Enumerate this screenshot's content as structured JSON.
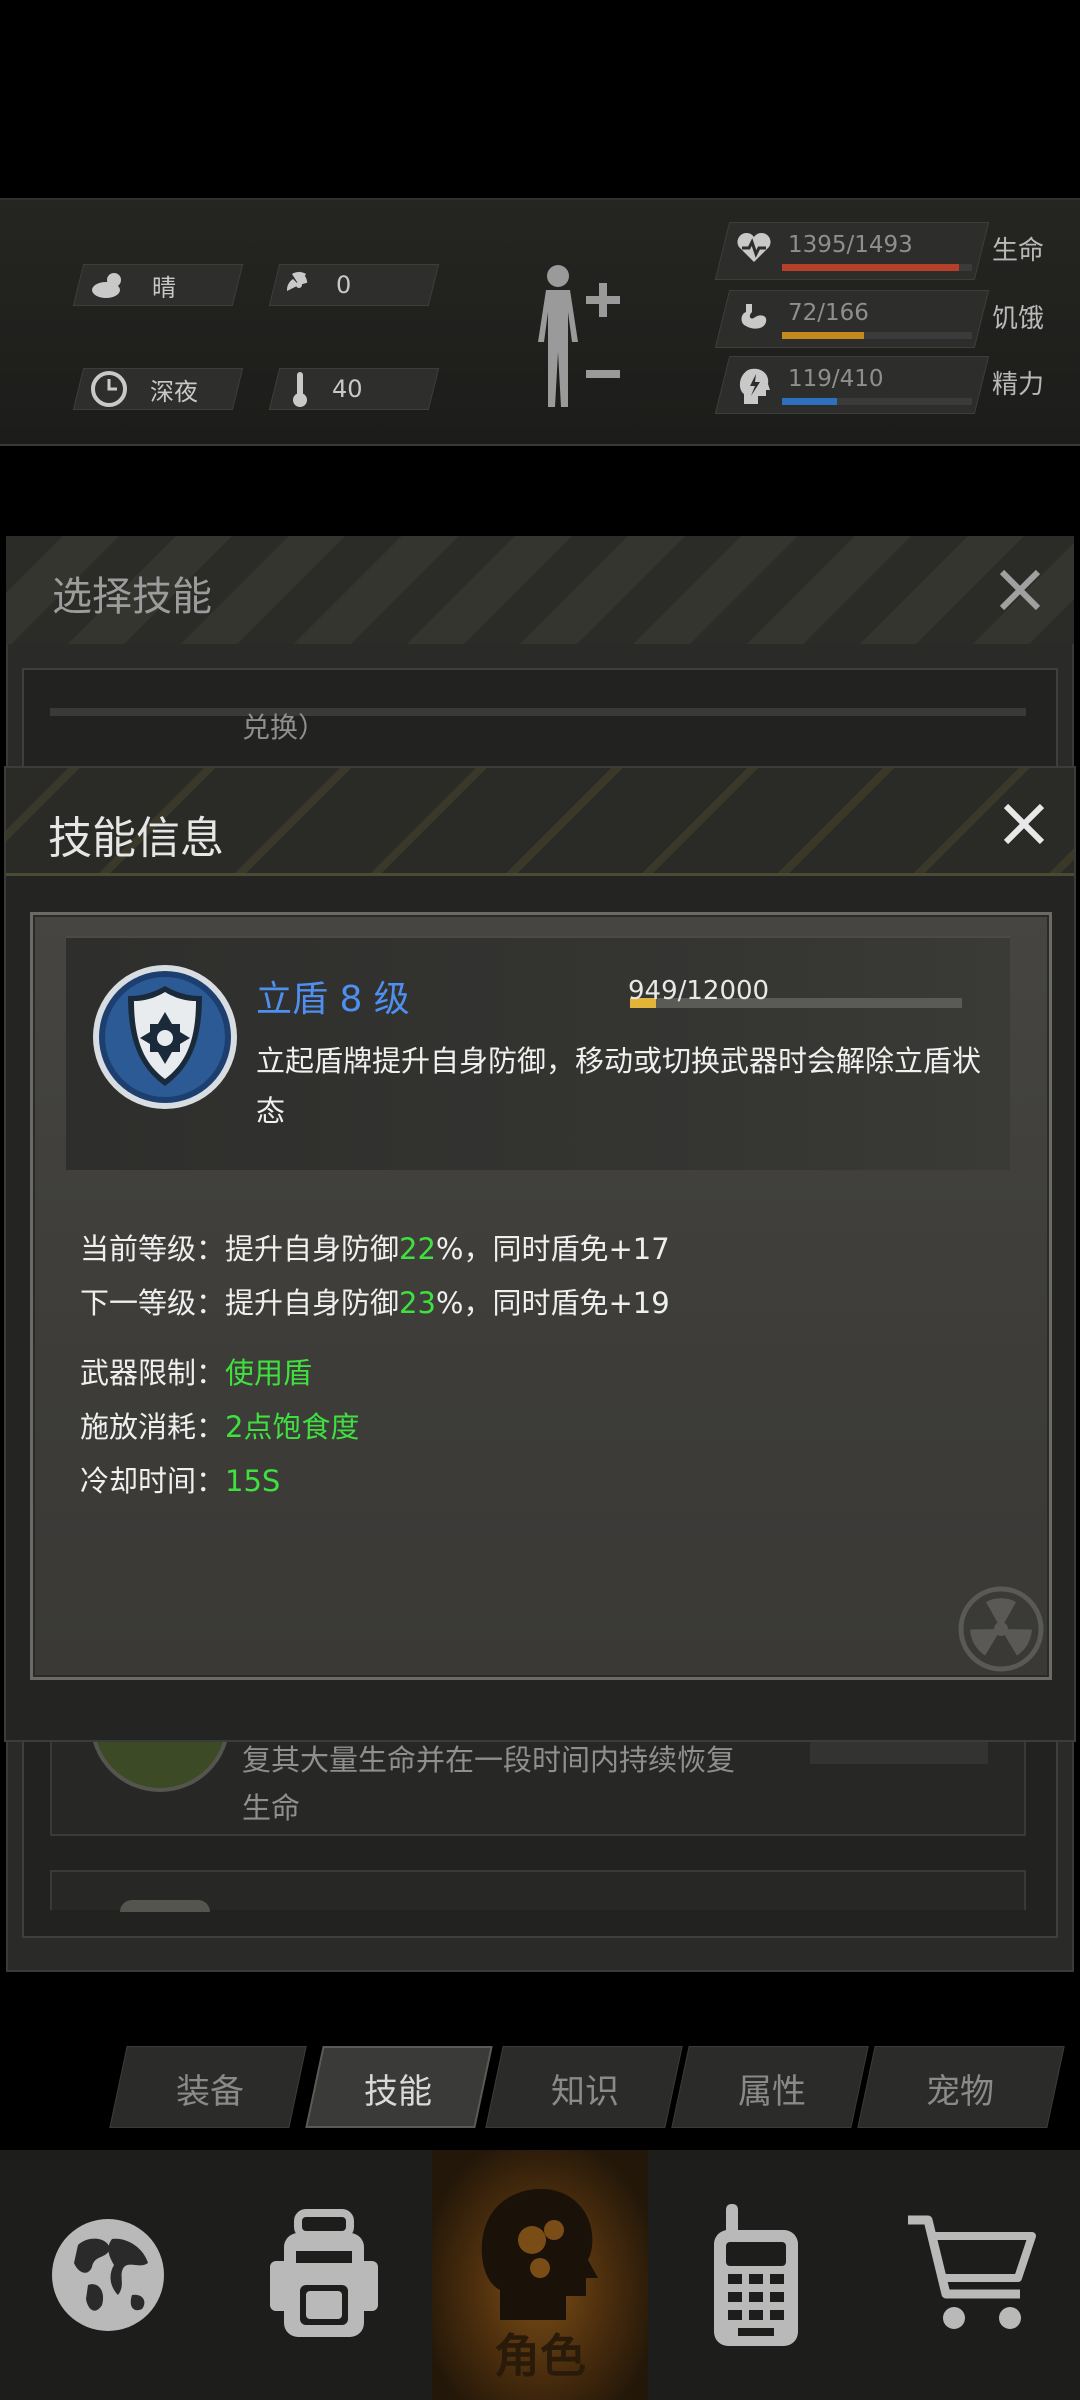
{
  "status": {
    "weather": {
      "label": "晴",
      "icon": "cloud-sun-icon"
    },
    "radiation": {
      "value": "0",
      "icon": "radiation-icon"
    },
    "time": {
      "label": "深夜",
      "icon": "clock-icon"
    },
    "temperature": {
      "value": "40",
      "icon": "thermometer-icon"
    },
    "stats": [
      {
        "id": "health",
        "value": "1395/1493",
        "label": "生命",
        "fraction": 0.934,
        "color": "#b6402b",
        "icon": "heart-pulse-icon"
      },
      {
        "id": "hunger",
        "value": "72/166",
        "label": "饥饿",
        "fraction": 0.434,
        "color": "#c58a1d",
        "icon": "stomach-icon"
      },
      {
        "id": "energy",
        "value": "119/410",
        "label": "精力",
        "fraction": 0.29,
        "color": "#2f6fc0",
        "icon": "energy-head-icon"
      }
    ]
  },
  "choose_dialog": {
    "title": "选择技能",
    "entry_text_1": "兑换）",
    "entry_text_2": "复其大量生命并在一段时间内持续恢复生命"
  },
  "info_dialog": {
    "title": "技能信息",
    "skill": {
      "name": "立盾 8 级",
      "exp": "949/12000",
      "exp_fraction": 0.079,
      "description": "立起盾牌提升自身防御，移动或切换武器时会解除立盾状态",
      "icon": "shield-cross-icon"
    },
    "current_level": {
      "prefix": "当前等级：提升自身防御",
      "value": "22",
      "suffix": "%，同时盾免+17"
    },
    "next_level": {
      "prefix": "下一等级：提升自身防御",
      "value": "23",
      "suffix": "%，同时盾免+19"
    },
    "weapon_limit": {
      "label": "武器限制：",
      "value": "使用盾"
    },
    "cost": {
      "label": "施放消耗：",
      "value": "2点饱食度"
    },
    "cooldown": {
      "label": "冷却时间：",
      "value": "15S"
    }
  },
  "tabs": [
    {
      "label": "装备",
      "active": false
    },
    {
      "label": "技能",
      "active": true
    },
    {
      "label": "知识",
      "active": false
    },
    {
      "label": "属性",
      "active": false
    },
    {
      "label": "宠物",
      "active": false
    }
  ],
  "nav": {
    "character_label": "角色",
    "items": [
      "globe-icon",
      "backpack-icon",
      "character-icon",
      "radio-icon",
      "cart-icon"
    ]
  }
}
